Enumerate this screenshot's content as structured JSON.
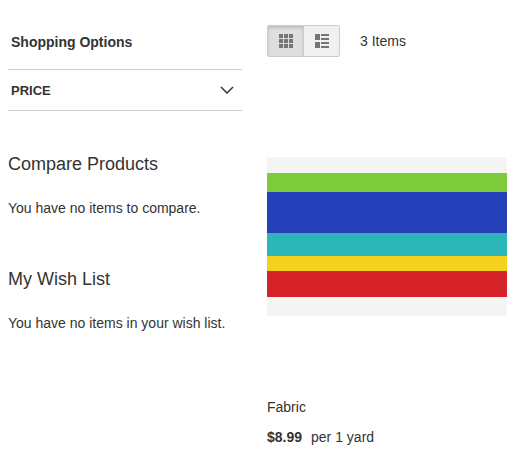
{
  "sidebar": {
    "title": "Shopping Options",
    "filters": [
      {
        "label": "PRICE",
        "expanded": false
      }
    ],
    "compare": {
      "title": "Compare Products",
      "message": "You have no items to compare."
    },
    "wishlist": {
      "title": "My Wish List",
      "message": "You have no items in your wish list."
    }
  },
  "toolbar": {
    "modes": [
      {
        "kind": "grid",
        "selected": true
      },
      {
        "kind": "list",
        "selected": false
      }
    ],
    "count": "3 Items"
  },
  "products": [
    {
      "name": "Fabric",
      "price": "$8.99",
      "unit": "per 1 yard"
    }
  ]
}
